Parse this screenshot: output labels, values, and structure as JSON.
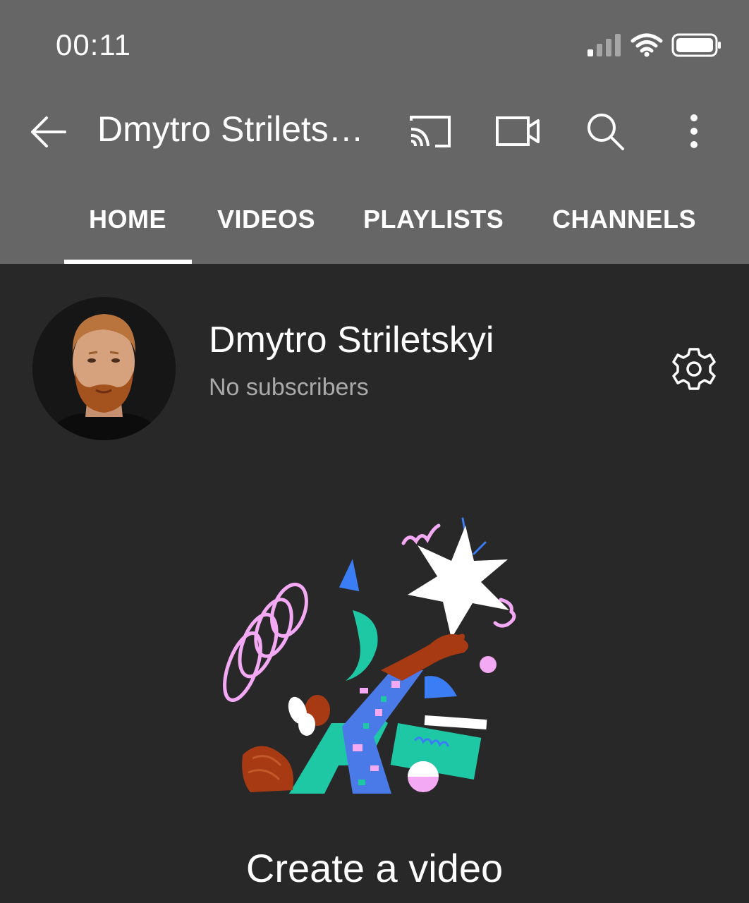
{
  "status_bar": {
    "time": "00:11",
    "icons": [
      "signal-icon",
      "wifi-icon",
      "battery-icon"
    ]
  },
  "header": {
    "title": "Dmytro Strilets…",
    "icons": [
      "back-arrow-icon",
      "cast-icon",
      "camera-icon",
      "search-icon",
      "more-vert-icon"
    ]
  },
  "tabs": [
    {
      "label": "HOME",
      "active": true
    },
    {
      "label": "VIDEOS",
      "active": false
    },
    {
      "label": "PLAYLISTS",
      "active": false
    },
    {
      "label": "CHANNELS",
      "active": false
    }
  ],
  "channel": {
    "name": "Dmytro Striletskyi",
    "subscribers": "No subscribers"
  },
  "empty_state": {
    "title": "Create a video"
  },
  "colors": {
    "header_bg": "#666666",
    "page_bg": "#282828",
    "text_primary": "#ffffff",
    "text_secondary": "#aaaaaa"
  }
}
